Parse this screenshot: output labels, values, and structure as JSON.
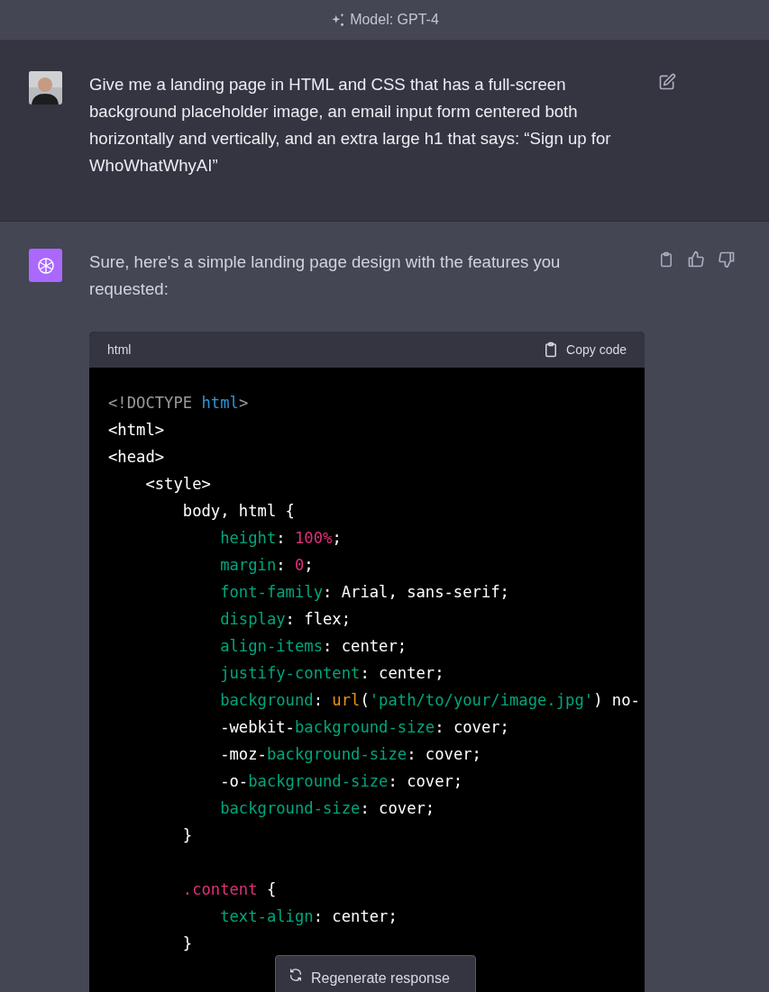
{
  "header": {
    "model_label": "Model: GPT-4"
  },
  "messages": [
    {
      "kind": "prompt",
      "text": "Give me a landing page in HTML and CSS that has a full-screen background placeholder image, an email input form centered both horizontally and vertically, and an extra large h1 that says: “Sign up for WhoWhatWhyAI”"
    },
    {
      "kind": "reply",
      "text": "Sure, here's a simple landing page design with the features you requested:",
      "code_block": {
        "language": "html",
        "copy_label": "Copy code",
        "lines": [
          {
            "tokens": [
              {
                "kind": "punct",
                "text": "<!DOCTYPE "
              },
              {
                "kind": "keyword",
                "text": "html"
              },
              {
                "kind": "punct",
                "text": ">"
              }
            ]
          },
          {
            "tokens": [
              {
                "kind": "plain",
                "text": "<html>"
              }
            ]
          },
          {
            "tokens": [
              {
                "kind": "plain",
                "text": "<head>"
              }
            ],
            "children": [
              {
                "tokens": [
                  {
                    "kind": "plain",
                    "text": "<style>"
                  }
                ],
                "children": [
                  {
                    "tokens": [
                      {
                        "kind": "plain",
                        "text": "body, html {"
                      }
                    ],
                    "children": [
                      {
                        "tokens": [
                          {
                            "kind": "property",
                            "text": "height"
                          },
                          {
                            "kind": "plain",
                            "text": ": "
                          },
                          {
                            "kind": "number",
                            "text": "100%"
                          },
                          {
                            "kind": "plain",
                            "text": ";"
                          }
                        ]
                      },
                      {
                        "tokens": [
                          {
                            "kind": "property",
                            "text": "margin"
                          },
                          {
                            "kind": "plain",
                            "text": ": "
                          },
                          {
                            "kind": "number",
                            "text": "0"
                          },
                          {
                            "kind": "plain",
                            "text": ";"
                          }
                        ]
                      },
                      {
                        "tokens": [
                          {
                            "kind": "property",
                            "text": "font-family"
                          },
                          {
                            "kind": "plain",
                            "text": ": Arial, sans-serif;"
                          }
                        ]
                      },
                      {
                        "tokens": [
                          {
                            "kind": "property",
                            "text": "display"
                          },
                          {
                            "kind": "plain",
                            "text": ": flex;"
                          }
                        ]
                      },
                      {
                        "tokens": [
                          {
                            "kind": "property",
                            "text": "align-items"
                          },
                          {
                            "kind": "plain",
                            "text": ": center;"
                          }
                        ]
                      },
                      {
                        "tokens": [
                          {
                            "kind": "property",
                            "text": "justify-content"
                          },
                          {
                            "kind": "plain",
                            "text": ": center;"
                          }
                        ]
                      },
                      {
                        "tokens": [
                          {
                            "kind": "property",
                            "text": "background"
                          },
                          {
                            "kind": "plain",
                            "text": ": "
                          },
                          {
                            "kind": "function",
                            "text": "url"
                          },
                          {
                            "kind": "plain",
                            "text": "("
                          },
                          {
                            "kind": "string",
                            "text": "'path/to/your/image.jpg'"
                          },
                          {
                            "kind": "plain",
                            "text": ") no-"
                          }
                        ]
                      },
                      {
                        "tokens": [
                          {
                            "kind": "plain",
                            "text": "-webkit-"
                          },
                          {
                            "kind": "property",
                            "text": "background-size"
                          },
                          {
                            "kind": "plain",
                            "text": ": cover;"
                          }
                        ]
                      },
                      {
                        "tokens": [
                          {
                            "kind": "plain",
                            "text": "-moz-"
                          },
                          {
                            "kind": "property",
                            "text": "background-size"
                          },
                          {
                            "kind": "plain",
                            "text": ": cover;"
                          }
                        ]
                      },
                      {
                        "tokens": [
                          {
                            "kind": "plain",
                            "text": "-o-"
                          },
                          {
                            "kind": "property",
                            "text": "background-size"
                          },
                          {
                            "kind": "plain",
                            "text": ": cover;"
                          }
                        ]
                      },
                      {
                        "tokens": [
                          {
                            "kind": "property",
                            "text": "background-size"
                          },
                          {
                            "kind": "plain",
                            "text": ": cover;"
                          }
                        ]
                      }
                    ]
                  },
                  {
                    "tokens": [
                      {
                        "kind": "plain",
                        "text": "}"
                      }
                    ]
                  },
                  {
                    "blank_before": true,
                    "tokens": [
                      {
                        "kind": "selector",
                        "text": ".content"
                      },
                      {
                        "kind": "plain",
                        "text": " {"
                      }
                    ],
                    "children": [
                      {
                        "tokens": [
                          {
                            "kind": "property",
                            "text": "text-align"
                          },
                          {
                            "kind": "plain",
                            "text": ": center;"
                          }
                        ]
                      }
                    ]
                  },
                  {
                    "tokens": [
                      {
                        "kind": "plain",
                        "text": "}"
                      }
                    ]
                  }
                ]
              }
            ]
          }
        ]
      }
    }
  ],
  "regenerate_button": {
    "label": "Regenerate response"
  }
}
